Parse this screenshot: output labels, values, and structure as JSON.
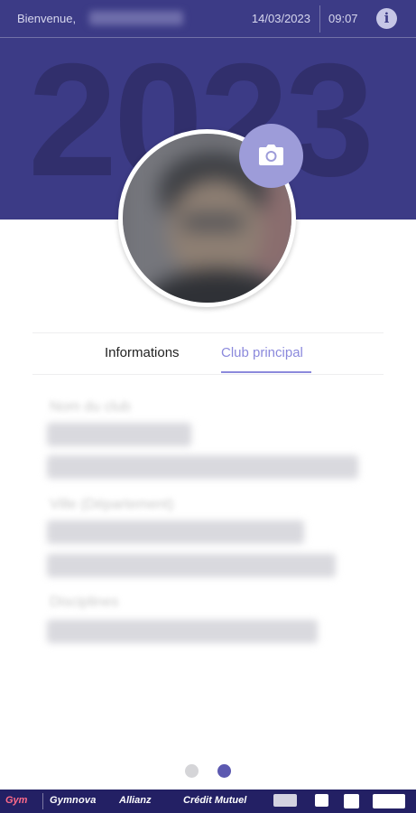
{
  "header": {
    "welcome": "Bienvenue,",
    "date": "14/03/2023",
    "time": "09:07",
    "info_icon": "info-icon"
  },
  "banner": {
    "year": "2023",
    "background_color": "#3c3b86"
  },
  "profile": {
    "camera_icon": "camera-icon"
  },
  "tabs": [
    {
      "label": "Informations",
      "active": false
    },
    {
      "label": "Club principal",
      "active": true
    }
  ],
  "club": {
    "fields": [
      {
        "label": "Nom du club"
      },
      {
        "label": "Ville (Département)"
      },
      {
        "label": "Disciplines"
      }
    ]
  },
  "pager": {
    "total": 2,
    "active": 2
  },
  "sponsors": [
    {
      "name": "Gym"
    },
    {
      "name": "Gymnova"
    },
    {
      "name": "Allianz"
    },
    {
      "name": "Crédit Mutuel"
    }
  ],
  "colors": {
    "accent": "#8b89dc",
    "camera_button": "#9d9cd9",
    "sponsor_bar": "#232064"
  }
}
